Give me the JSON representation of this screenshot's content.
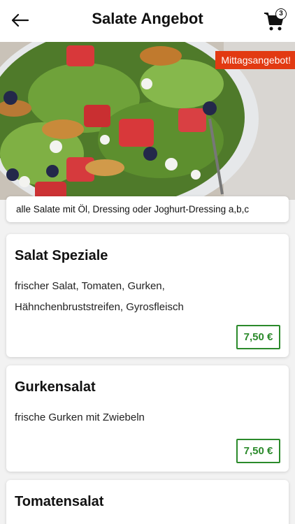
{
  "header": {
    "title": "Salate Angebot",
    "cart_count": "3"
  },
  "hero": {
    "badge": "Mittagsangebot!"
  },
  "note": "alle Salate mit Öl, Dressing oder Joghurt-Dressing a,b,c",
  "items": [
    {
      "title": "Salat Speziale",
      "desc": "frischer Salat, Tomaten, Gurken, Hähnchenbruststreifen, Gyrosfleisch",
      "price": "7,50 €"
    },
    {
      "title": "Gurkensalat",
      "desc": "frische Gurken mit Zwiebeln",
      "price": "7,50 €"
    },
    {
      "title": "Tomatensalat"
    }
  ],
  "colors": {
    "accent_red": "#e23a12",
    "price_green": "#2b8a2b"
  },
  "icons": [
    "back-arrow-icon",
    "cart-icon"
  ]
}
